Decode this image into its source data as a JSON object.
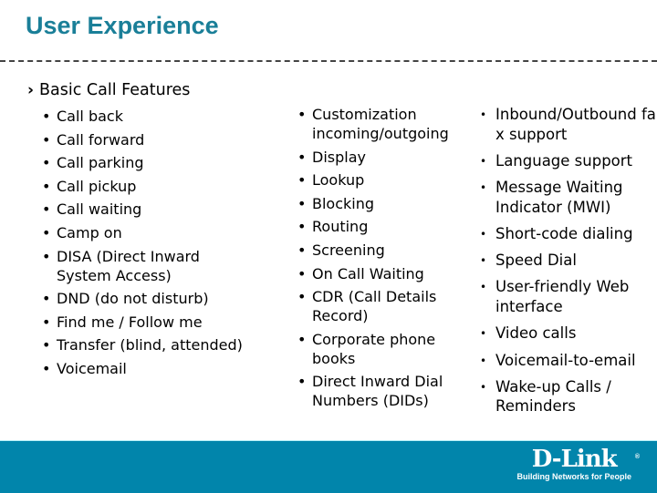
{
  "slide": {
    "title": "User Experience",
    "section_heading": "Basic Call Features"
  },
  "columns": {
    "col1": [
      "Call back",
      "Call forward",
      "Call parking",
      "Call pickup",
      "Call waiting",
      "Camp on",
      "DISA (Direct Inward System Access)",
      "DND (do not disturb)",
      "Find me / Follow me",
      "Transfer (blind, attended)",
      "Voicemail"
    ],
    "col2": [
      "Customization incoming/outgoing",
      "Display",
      "Lookup",
      "Blocking",
      "Routing",
      "Screening",
      "On Call Waiting",
      "CDR (Call Details Record)",
      "Corporate phone books",
      "Direct Inward Dial Numbers (DIDs)"
    ],
    "col3": [
      "Inbound/Outbound fax support",
      "Language support",
      "Message Waiting Indicator (MWI)",
      "Short-code dialing",
      "Speed Dial",
      "User-friendly Web interface",
      "Video calls",
      "Voicemail-to-email",
      "Wake-up Calls / Reminders"
    ]
  },
  "footer": {
    "brand": "D-Link",
    "registered": "®",
    "tagline": "Building Networks for People",
    "color": "#0185ab"
  },
  "colors": {
    "title": "#1a7f98"
  },
  "icons": {
    "section": "chevron-right-icon",
    "bullet": "bullet-icon"
  }
}
